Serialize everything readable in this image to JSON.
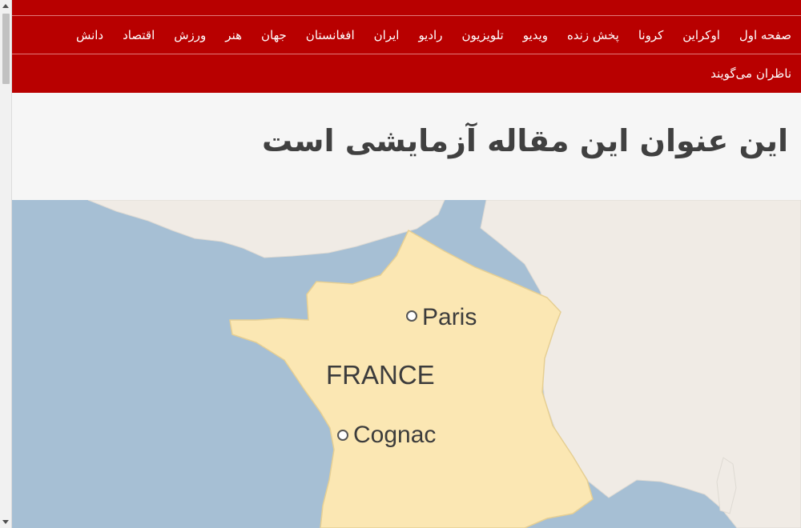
{
  "nav": {
    "items": [
      "صفحه اول",
      "اوکراین",
      "کرونا",
      "پخش زنده",
      "ویدیو",
      "تلویزیون",
      "رادیو",
      "ایران",
      "افغانستان",
      "جهان",
      "هنر",
      "ورزش",
      "اقتصاد",
      "دانش"
    ],
    "row2": [
      "ناظران می‌گویند"
    ]
  },
  "article": {
    "title": "این عنوان این مقاله آزمایشی است"
  },
  "map": {
    "country": "FRANCE",
    "cities": [
      "Paris",
      "Cognac"
    ]
  },
  "colors": {
    "brand": "#b80000",
    "sea": "#a6bfd4",
    "land": "#f0ebe5",
    "france": "#fbe7b3"
  }
}
